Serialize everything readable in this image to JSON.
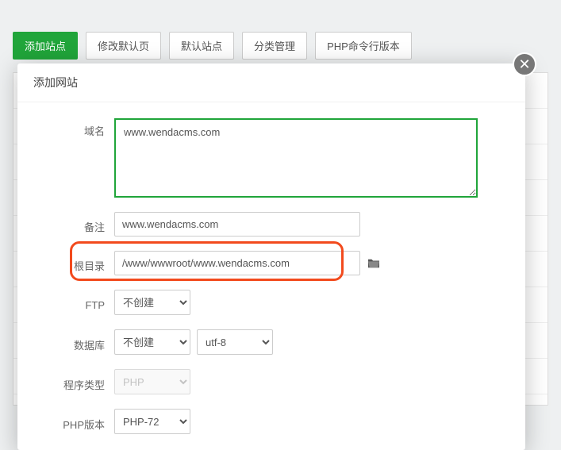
{
  "toolbar": {
    "add_site": "添加站点",
    "modify_default": "修改默认页",
    "default_site": "默认站点",
    "category_mgmt": "分类管理",
    "php_cli_version": "PHP命令行版本"
  },
  "modal": {
    "title": "添加网站",
    "labels": {
      "domain": "域名",
      "note": "备注",
      "root_dir": "根目录",
      "ftp": "FTP",
      "database": "数据库",
      "program_type": "程序类型",
      "php_version": "PHP版本"
    },
    "values": {
      "domain": "www.wendacms.com",
      "note": "www.wendacms.com",
      "root_dir": "/www/wwwroot/www.wendacms.com",
      "ftp": "不创建",
      "database": "不创建",
      "charset": "utf-8",
      "program_type": "PHP",
      "php_version": "PHP-72"
    }
  }
}
